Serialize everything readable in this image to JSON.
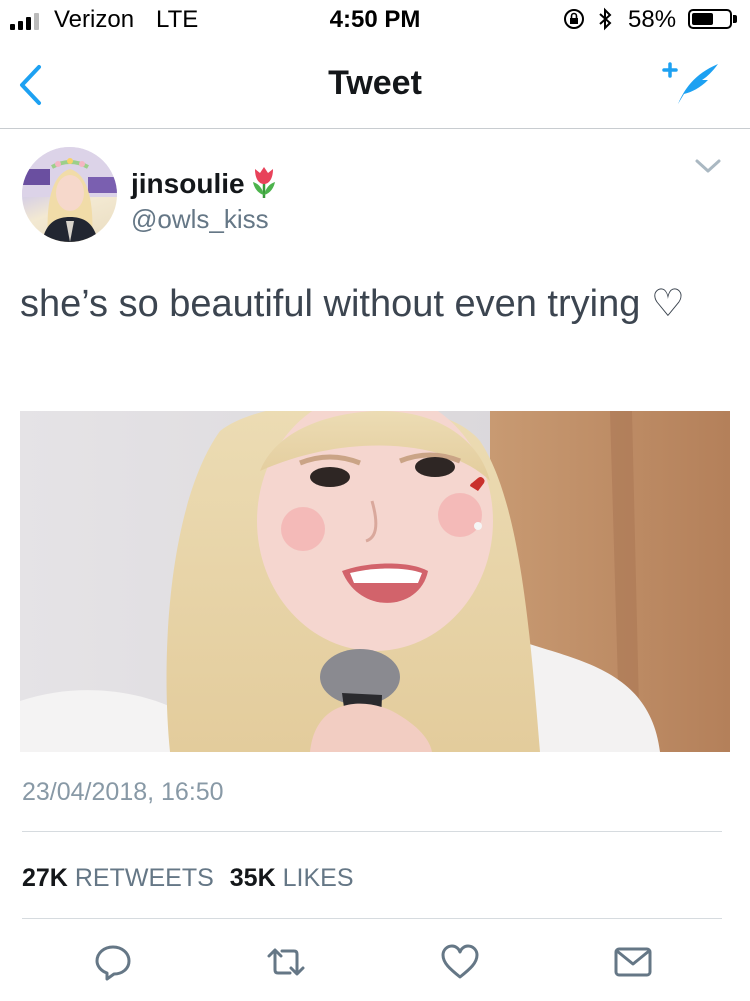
{
  "status_bar": {
    "carrier": "Verizon",
    "network": "LTE",
    "time": "4:50 PM",
    "battery_percent": "58%",
    "battery_level": 0.58
  },
  "nav": {
    "title": "Tweet",
    "back_icon": "chevron-left-icon",
    "compose_icon": "compose-tweet-icon"
  },
  "tweet": {
    "display_name": "jinsoulie",
    "name_emoji": "tulip",
    "handle": "@owls_kiss",
    "text": "she’s so beautiful without even trying ♡",
    "timestamp": "23/04/2018, 16:50",
    "stats": {
      "retweets_count": "27K",
      "retweets_label": "RETWEETS",
      "likes_count": "35K",
      "likes_label": "LIKES"
    }
  },
  "actions": [
    {
      "name": "reply",
      "icon": "reply-icon"
    },
    {
      "name": "retweet",
      "icon": "retweet-icon"
    },
    {
      "name": "like",
      "icon": "heart-icon"
    },
    {
      "name": "share",
      "icon": "envelope-icon"
    }
  ],
  "colors": {
    "accent": "#1da1f2",
    "text_primary": "#14171a",
    "text_secondary": "#657786",
    "divider": "#d6dbdf"
  }
}
